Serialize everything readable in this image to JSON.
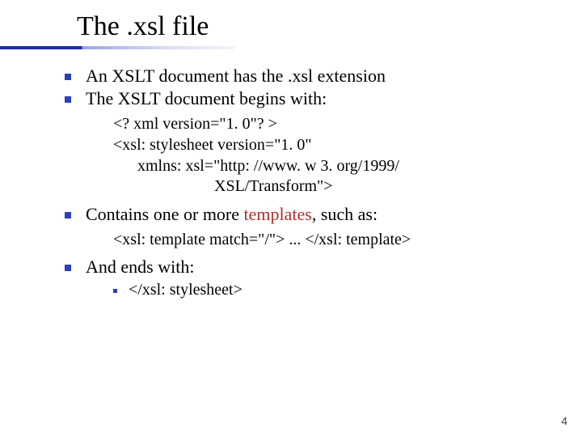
{
  "title": {
    "pre": "The ",
    "xsl": ".xsl",
    "post": " file"
  },
  "b1": {
    "pre": "An XSLT document has the ",
    "xsl": ".xsl",
    "post": " extension"
  },
  "b2": "The XSLT document begins with:",
  "code1": "<? xml version=\"1. 0\"? >\n<xsl: stylesheet version=\"1. 0\"\n      xmlns: xsl=\"http: //www. w 3. org/1999/\n                         XSL/Transform\">",
  "b3": {
    "pre": "Contains one or more ",
    "hl": "templates",
    "post": ", such as:"
  },
  "code2": "<xsl: template match=\"/\"> ... </xsl: template>",
  "b4": "And ends with:",
  "code3": "</xsl: stylesheet>",
  "page": "4"
}
